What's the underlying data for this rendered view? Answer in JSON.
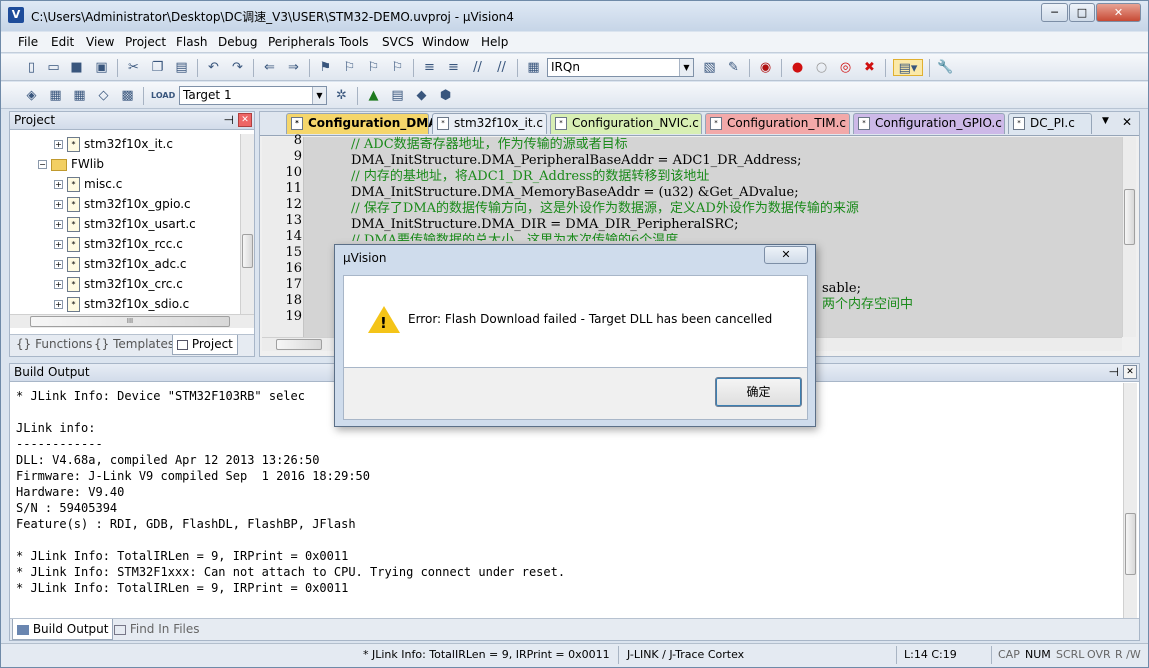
{
  "window": {
    "title": "C:\\Users\\Administrator\\Desktop\\DC调速_V3\\USER\\STM32-DEMO.uvproj - µVision4",
    "app_letter": "V"
  },
  "menu": [
    "File",
    "Edit",
    "View",
    "Project",
    "Flash",
    "Debug",
    "Peripherals",
    "Tools",
    "SVCS",
    "Window",
    "Help"
  ],
  "toolbar": {
    "find_combo": "IRQn",
    "target_combo": "Target 1"
  },
  "project_panel": {
    "title": "Project",
    "tree": [
      {
        "label": "stm32f10x_it.c",
        "indent": 2
      },
      {
        "label": "FWlib",
        "indent": 1,
        "folder": true
      },
      {
        "label": "misc.c",
        "indent": 2
      },
      {
        "label": "stm32f10x_gpio.c",
        "indent": 2
      },
      {
        "label": "stm32f10x_usart.c",
        "indent": 2
      },
      {
        "label": "stm32f10x_rcc.c",
        "indent": 2
      },
      {
        "label": "stm32f10x_adc.c",
        "indent": 2
      },
      {
        "label": "stm32f10x_crc.c",
        "indent": 2
      },
      {
        "label": "stm32f10x_sdio.c",
        "indent": 2
      }
    ],
    "tabs": [
      "Functions",
      "Templates",
      "Project"
    ],
    "tab_prefixes": [
      "{}",
      "{}"
    ],
    "hscroll_mark": "III"
  },
  "editor": {
    "tabs": [
      {
        "label": "Configuration_DMA.c",
        "color": "#f5d66b",
        "active": true
      },
      {
        "label": "stm32f10x_it.c",
        "color": "#e9eef5"
      },
      {
        "label": "Configuration_NVIC.c",
        "color": "#d8efb4"
      },
      {
        "label": "Configuration_TIM.c",
        "color": "#f2a9a9"
      },
      {
        "label": "Configuration_GPIO.c",
        "color": "#cdb9e8"
      },
      {
        "label": "DC_PI.c",
        "color": "#dde6f0"
      }
    ],
    "tab_menu": "▼",
    "tab_close": "✕",
    "line_numbers": [
      "8",
      "9",
      "10",
      "11",
      "12",
      "13",
      "14",
      "15",
      "16",
      "17",
      "18",
      "19"
    ],
    "lines": [
      {
        "text": "// ADC数据寄存器地址，作为传输的源或者目标",
        "comment": true
      },
      {
        "text": "DMA_InitStructure.DMA_PeripheralBaseAddr = ADC1_DR_Address;",
        "comment": false
      },
      {
        "text": "// 内存的基地址，将ADC1_DR_Address的数据转移到该地址",
        "comment": true
      },
      {
        "text": "DMA_InitStructure.DMA_MemoryBaseAddr = (u32) &Get_ADvalue;",
        "comment": false
      },
      {
        "text": "// 保存了DMA的数据传输方向，这是外设作为数据源，定义AD外设作为数据传输的来源",
        "comment": true
      },
      {
        "text": "DMA_InitStructure.DMA_DIR = DMA_DIR_PeripheralSRC;",
        "comment": false
      },
      {
        "text": "// DMA要传输数据的总大小，这里为本次传输的6个温度",
        "comment": true
      }
    ],
    "right_fragments": {
      "sable": "sable;",
      "space": "两个内存空间中"
    }
  },
  "build": {
    "title": "Build Output",
    "text": "* JLink Info: Device \"STM32F103RB\" selec\n\nJLink info:\n------------\nDLL: V4.68a, compiled Apr 12 2013 13:26:50\nFirmware: J-Link V9 compiled Sep  1 2016 18:29:50\nHardware: V9.40\nS/N : 59405394\nFeature(s) : RDI, GDB, FlashDL, FlashBP, JFlash\n\n* JLink Info: TotalIRLen = 9, IRPrint = 0x0011\n* JLink Info: STM32F1xxx: Can not attach to CPU. Trying connect under reset.\n* JLink Info: TotalIRLen = 9, IRPrint = 0x0011",
    "tabs": [
      "Build Output",
      "Find In Files"
    ]
  },
  "status": {
    "message": "* JLink Info: TotalIRLen = 9, IRPrint = 0x0011",
    "debugger": "J-LINK / J-Trace Cortex",
    "position": "L:14 C:19",
    "indicators": [
      "CAP",
      "NUM",
      "SCRL",
      "OVR",
      "R /W"
    ]
  },
  "dialog": {
    "title": "µVision",
    "message": "Error: Flash Download failed  -  Target DLL has been cancelled",
    "ok_label": "确定",
    "warn_mark": "!"
  },
  "panel_controls": {
    "pin": "⊣",
    "close": "✕"
  },
  "win_controls": {
    "minimize": "─",
    "maximize": "□",
    "close": "✕"
  }
}
